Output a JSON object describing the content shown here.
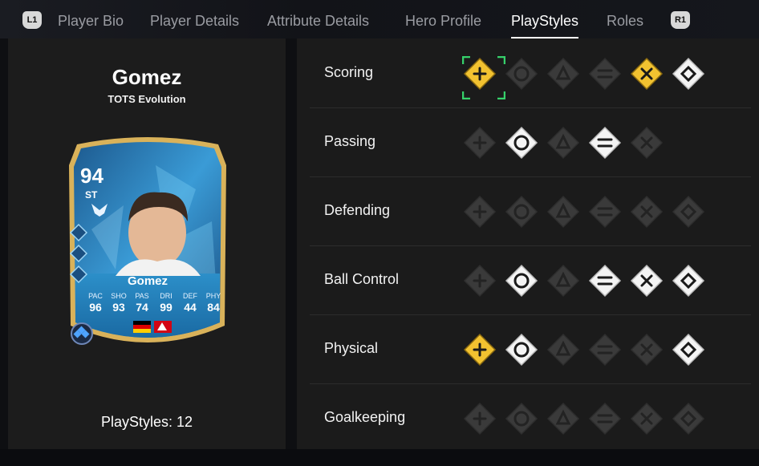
{
  "tabs": {
    "left_bumper": "L1",
    "right_bumper": "R1",
    "items": [
      {
        "label": "Player Bio"
      },
      {
        "label": "Player Details"
      },
      {
        "label": "Attribute Details"
      },
      {
        "label": "Hero Profile"
      },
      {
        "label": "PlayStyles"
      },
      {
        "label": "Roles"
      }
    ],
    "active": "PlayStyles"
  },
  "player": {
    "name": "Gomez",
    "version": "TOTS Evolution",
    "playstyles_count": "PlayStyles: 12"
  },
  "card": {
    "rating": "94",
    "position": "ST",
    "name": "Gomez",
    "stats": [
      {
        "label": "PAC",
        "value": "96"
      },
      {
        "label": "SHO",
        "value": "93"
      },
      {
        "label": "PAS",
        "value": "74"
      },
      {
        "label": "DRI",
        "value": "99"
      },
      {
        "label": "DEF",
        "value": "44"
      },
      {
        "label": "PHY",
        "value": "84"
      }
    ]
  },
  "categories": [
    {
      "label": "Scoring",
      "icons": [
        {
          "icon": "power-shot-icon",
          "state": "plus",
          "selected": true
        },
        {
          "icon": "dead-ball-icon",
          "state": "none"
        },
        {
          "icon": "chip-shot-icon",
          "state": "none"
        },
        {
          "icon": "finesse-shot-icon",
          "state": "none"
        },
        {
          "icon": "acrobatic-icon",
          "state": "plus"
        },
        {
          "icon": "low-driven-shot-icon",
          "state": "active"
        }
      ]
    },
    {
      "label": "Passing",
      "icons": [
        {
          "icon": "incisive-pass-icon",
          "state": "none"
        },
        {
          "icon": "pinged-pass-icon",
          "state": "active"
        },
        {
          "icon": "long-ball-pass-icon",
          "state": "none"
        },
        {
          "icon": "tiki-taka-icon",
          "state": "active"
        },
        {
          "icon": "whipped-pass-icon",
          "state": "none"
        }
      ]
    },
    {
      "label": "Defending",
      "icons": [
        {
          "icon": "jockey-icon",
          "state": "none"
        },
        {
          "icon": "block-icon",
          "state": "none"
        },
        {
          "icon": "intercept-icon",
          "state": "none"
        },
        {
          "icon": "anticipate-icon",
          "state": "none"
        },
        {
          "icon": "slide-tackle-icon",
          "state": "none"
        },
        {
          "icon": "bruiser-icon",
          "state": "none"
        }
      ]
    },
    {
      "label": "Ball Control",
      "icons": [
        {
          "icon": "tech-icon",
          "state": "none"
        },
        {
          "icon": "rapid-icon",
          "state": "active"
        },
        {
          "icon": "flair-icon",
          "state": "none"
        },
        {
          "icon": "first-touch-icon",
          "state": "active"
        },
        {
          "icon": "trickster-icon",
          "state": "active"
        },
        {
          "icon": "press-proven-icon",
          "state": "active"
        }
      ]
    },
    {
      "label": "Physical",
      "icons": [
        {
          "icon": "quick-step-icon",
          "state": "plus"
        },
        {
          "icon": "relentless-icon",
          "state": "active"
        },
        {
          "icon": "trivela-icon",
          "state": "none"
        },
        {
          "icon": "acrobatic-physical-icon",
          "state": "none"
        },
        {
          "icon": "aerial-icon",
          "state": "none"
        },
        {
          "icon": "long-throw-icon",
          "state": "active"
        }
      ]
    },
    {
      "label": "Goalkeeping",
      "icons": [
        {
          "icon": "far-throw-icon",
          "state": "none"
        },
        {
          "icon": "footwork-icon",
          "state": "none"
        },
        {
          "icon": "cross-claimer-icon",
          "state": "none"
        },
        {
          "icon": "rush-out-icon",
          "state": "none"
        },
        {
          "icon": "far-reach-icon",
          "state": "none"
        },
        {
          "icon": "deflector-icon",
          "state": "none"
        }
      ]
    }
  ],
  "colors": {
    "plus_gold": "#f2c230",
    "active_white": "#f4f4f4",
    "inactive_gray": "#3a3a3a",
    "selection_green": "#36d16b",
    "card_blue": "#2f7fbf",
    "card_gold": "#d9b25a"
  }
}
